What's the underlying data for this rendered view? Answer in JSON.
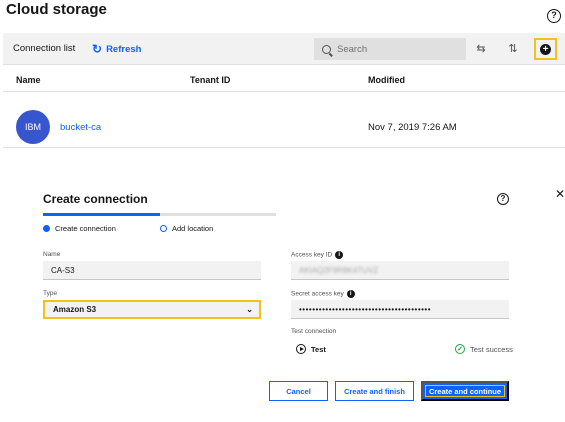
{
  "page": {
    "title": "Cloud storage",
    "help_icon": "help-icon"
  },
  "toolbar": {
    "title": "Connection list",
    "refresh_label": "Refresh",
    "refresh_icon": "refresh-icon",
    "search_placeholder": "Search",
    "search_value": "",
    "filter_icon": "filter-icon",
    "sort_icon": "sort-icon",
    "add_icon": "add-icon"
  },
  "table": {
    "columns": [
      "Name",
      "Tenant ID",
      "Modified"
    ],
    "rows": [
      {
        "avatar": "IBM",
        "name": "bucket-ca",
        "tenant_id": "",
        "modified": "Nov 7, 2019 7:26 AM"
      }
    ]
  },
  "modal": {
    "title": "Create connection",
    "steps": [
      {
        "label": "Create connection",
        "state": "current"
      },
      {
        "label": "Add location",
        "state": "incomplete"
      }
    ],
    "progress": 0.5,
    "fields": {
      "name": {
        "label": "Name",
        "value": "CA-S3"
      },
      "type": {
        "label": "Type",
        "value": "Amazon S3"
      },
      "access_key_id": {
        "label": "Access key ID",
        "value": "AKIAQ2F9R8K4TUVZ"
      },
      "secret_access_key": {
        "label": "Secret access key",
        "value": "••••••••••••••••••••••••••••••••••••••••"
      },
      "test_connection": {
        "label": "Test connection"
      }
    },
    "test_button": "Test",
    "test_status": "Test success",
    "buttons": {
      "cancel": "Cancel",
      "create_finish": "Create and finish",
      "create_continue": "Create and continue"
    }
  },
  "colors": {
    "accent": "#0f62fe",
    "highlight": "#f1c21b",
    "success": "#24a148",
    "avatar": "#3855d0"
  }
}
